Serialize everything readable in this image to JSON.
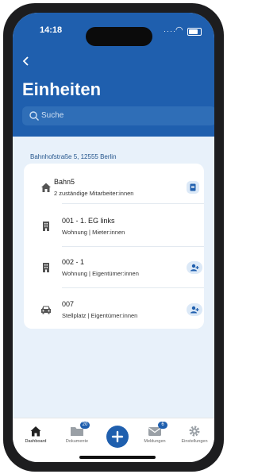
{
  "status_bar": {
    "time": "14:18"
  },
  "header": {
    "title": "Einheiten",
    "search_placeholder": "Suche"
  },
  "address": "Bahnhofstraße 5, 12555 Berlin",
  "building": {
    "name": "Bahn5",
    "subtitle": "2 zuständige Mitarbeiter:innen",
    "icon": "home-icon",
    "action_icon": "id-card-icon"
  },
  "units": [
    {
      "name": "001 - 1. EG links",
      "details": "Wohnung | Mieter:innen",
      "icon": "building-icon",
      "action_icon": ""
    },
    {
      "name": "002 - 1",
      "details": "Wohnung | Eigentümer:innen",
      "icon": "building-icon",
      "action_icon": "add-person-icon"
    },
    {
      "name": "007",
      "details": "Stellplatz | Eigentümer:innen",
      "icon": "car-icon",
      "action_icon": "add-person-icon"
    }
  ],
  "tabs": [
    {
      "label": "Dashboard",
      "icon": "home-icon",
      "active": true
    },
    {
      "label": "Dokumente",
      "icon": "folder-icon",
      "badge": "20"
    },
    {
      "label": "",
      "icon": "plus-icon"
    },
    {
      "label": "Meldungen",
      "icon": "mail-icon",
      "badge": "6"
    },
    {
      "label": "Einstellungen",
      "icon": "gear-icon"
    }
  ],
  "colors": {
    "primary": "#1f5fae",
    "background": "#e8f1fa",
    "card": "#ffffff"
  }
}
